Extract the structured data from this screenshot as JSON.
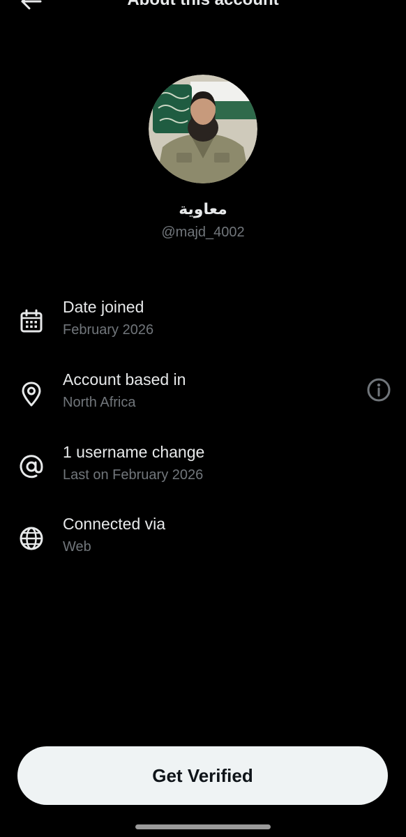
{
  "header": {
    "title": "About this account"
  },
  "profile": {
    "display_name": "معاوية",
    "handle": "@majd_4002"
  },
  "details": [
    {
      "icon": "calendar-icon",
      "label": "Date joined",
      "value": "February 2026"
    },
    {
      "icon": "location-pin-icon",
      "label": "Account based in",
      "value": "North Africa"
    },
    {
      "icon": "at-sign-icon",
      "label": "1 username change",
      "value": "Last on February 2026"
    },
    {
      "icon": "globe-icon",
      "label": "Connected via",
      "value": "Web"
    }
  ],
  "actions": {
    "get_verified_label": "Get Verified"
  },
  "colors": {
    "background": "#000000",
    "primary_text": "#e7e9ea",
    "secondary_text": "#71767b",
    "button_bg": "#eff3f4",
    "button_text": "#0f1419"
  }
}
